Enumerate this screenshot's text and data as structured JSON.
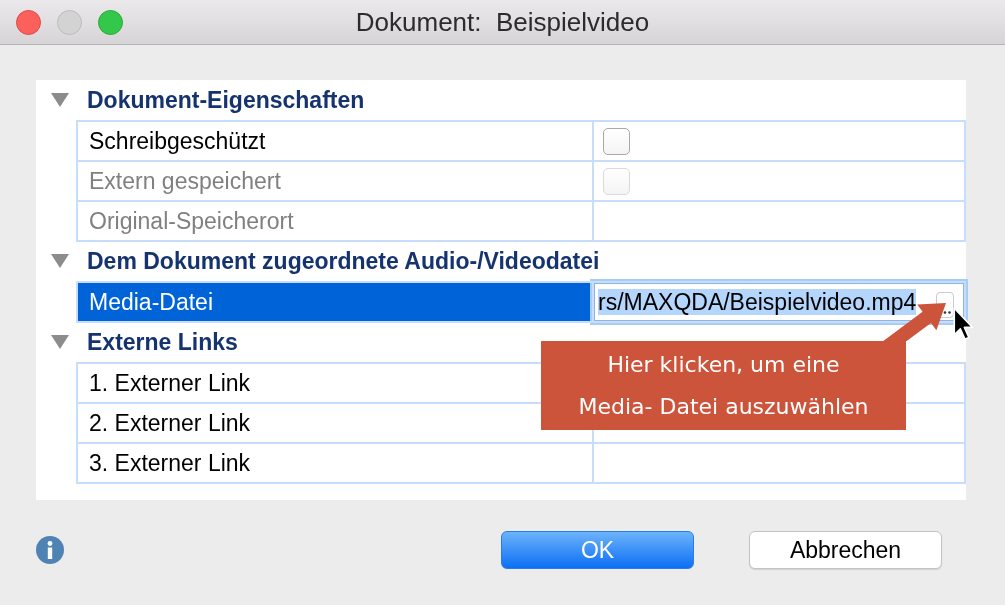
{
  "window": {
    "title": "Dokument:  Beispielvideo",
    "controls": [
      {
        "kind": "close",
        "disabled": false
      },
      {
        "kind": "minimize",
        "disabled": true
      },
      {
        "kind": "zoom",
        "disabled": false
      }
    ]
  },
  "sections": [
    {
      "title": "Dokument-Eigenschaften",
      "expanded": true,
      "rows": [
        {
          "label": "Schreibgeschützt",
          "kind": "checkbox",
          "checked": false,
          "disabled": false,
          "selected": false
        },
        {
          "label": "Extern gespeichert",
          "kind": "checkbox",
          "checked": false,
          "disabled": true,
          "selected": false
        },
        {
          "label": "Original-Speicherort",
          "kind": "text",
          "disabled": true,
          "selected": false
        }
      ]
    },
    {
      "title": "Dem Dokument zugeordnete Audio-/Videodatei",
      "expanded": true,
      "rows": [
        {
          "label": "Media-Datei",
          "kind": "file",
          "value": "rs/MAXQDA/Beispielvideo.mp4",
          "focused": true,
          "disabled": false,
          "selected": true
        }
      ]
    },
    {
      "title": "Externe Links",
      "expanded": true,
      "rows": [
        {
          "label": "1. Externer Link",
          "kind": "text",
          "disabled": false,
          "selected": false
        },
        {
          "label": "2. Externer Link",
          "kind": "text",
          "disabled": false,
          "selected": false
        },
        {
          "label": "3. Externer Link",
          "kind": "text",
          "disabled": false,
          "selected": false
        }
      ]
    }
  ],
  "callout": {
    "text": "Hier klicken, um eine\nMedia- Datei auszuwählen"
  },
  "buttons": [
    {
      "label": "OK",
      "default": true
    },
    {
      "label": "Abbrechen",
      "default": false
    }
  ]
}
